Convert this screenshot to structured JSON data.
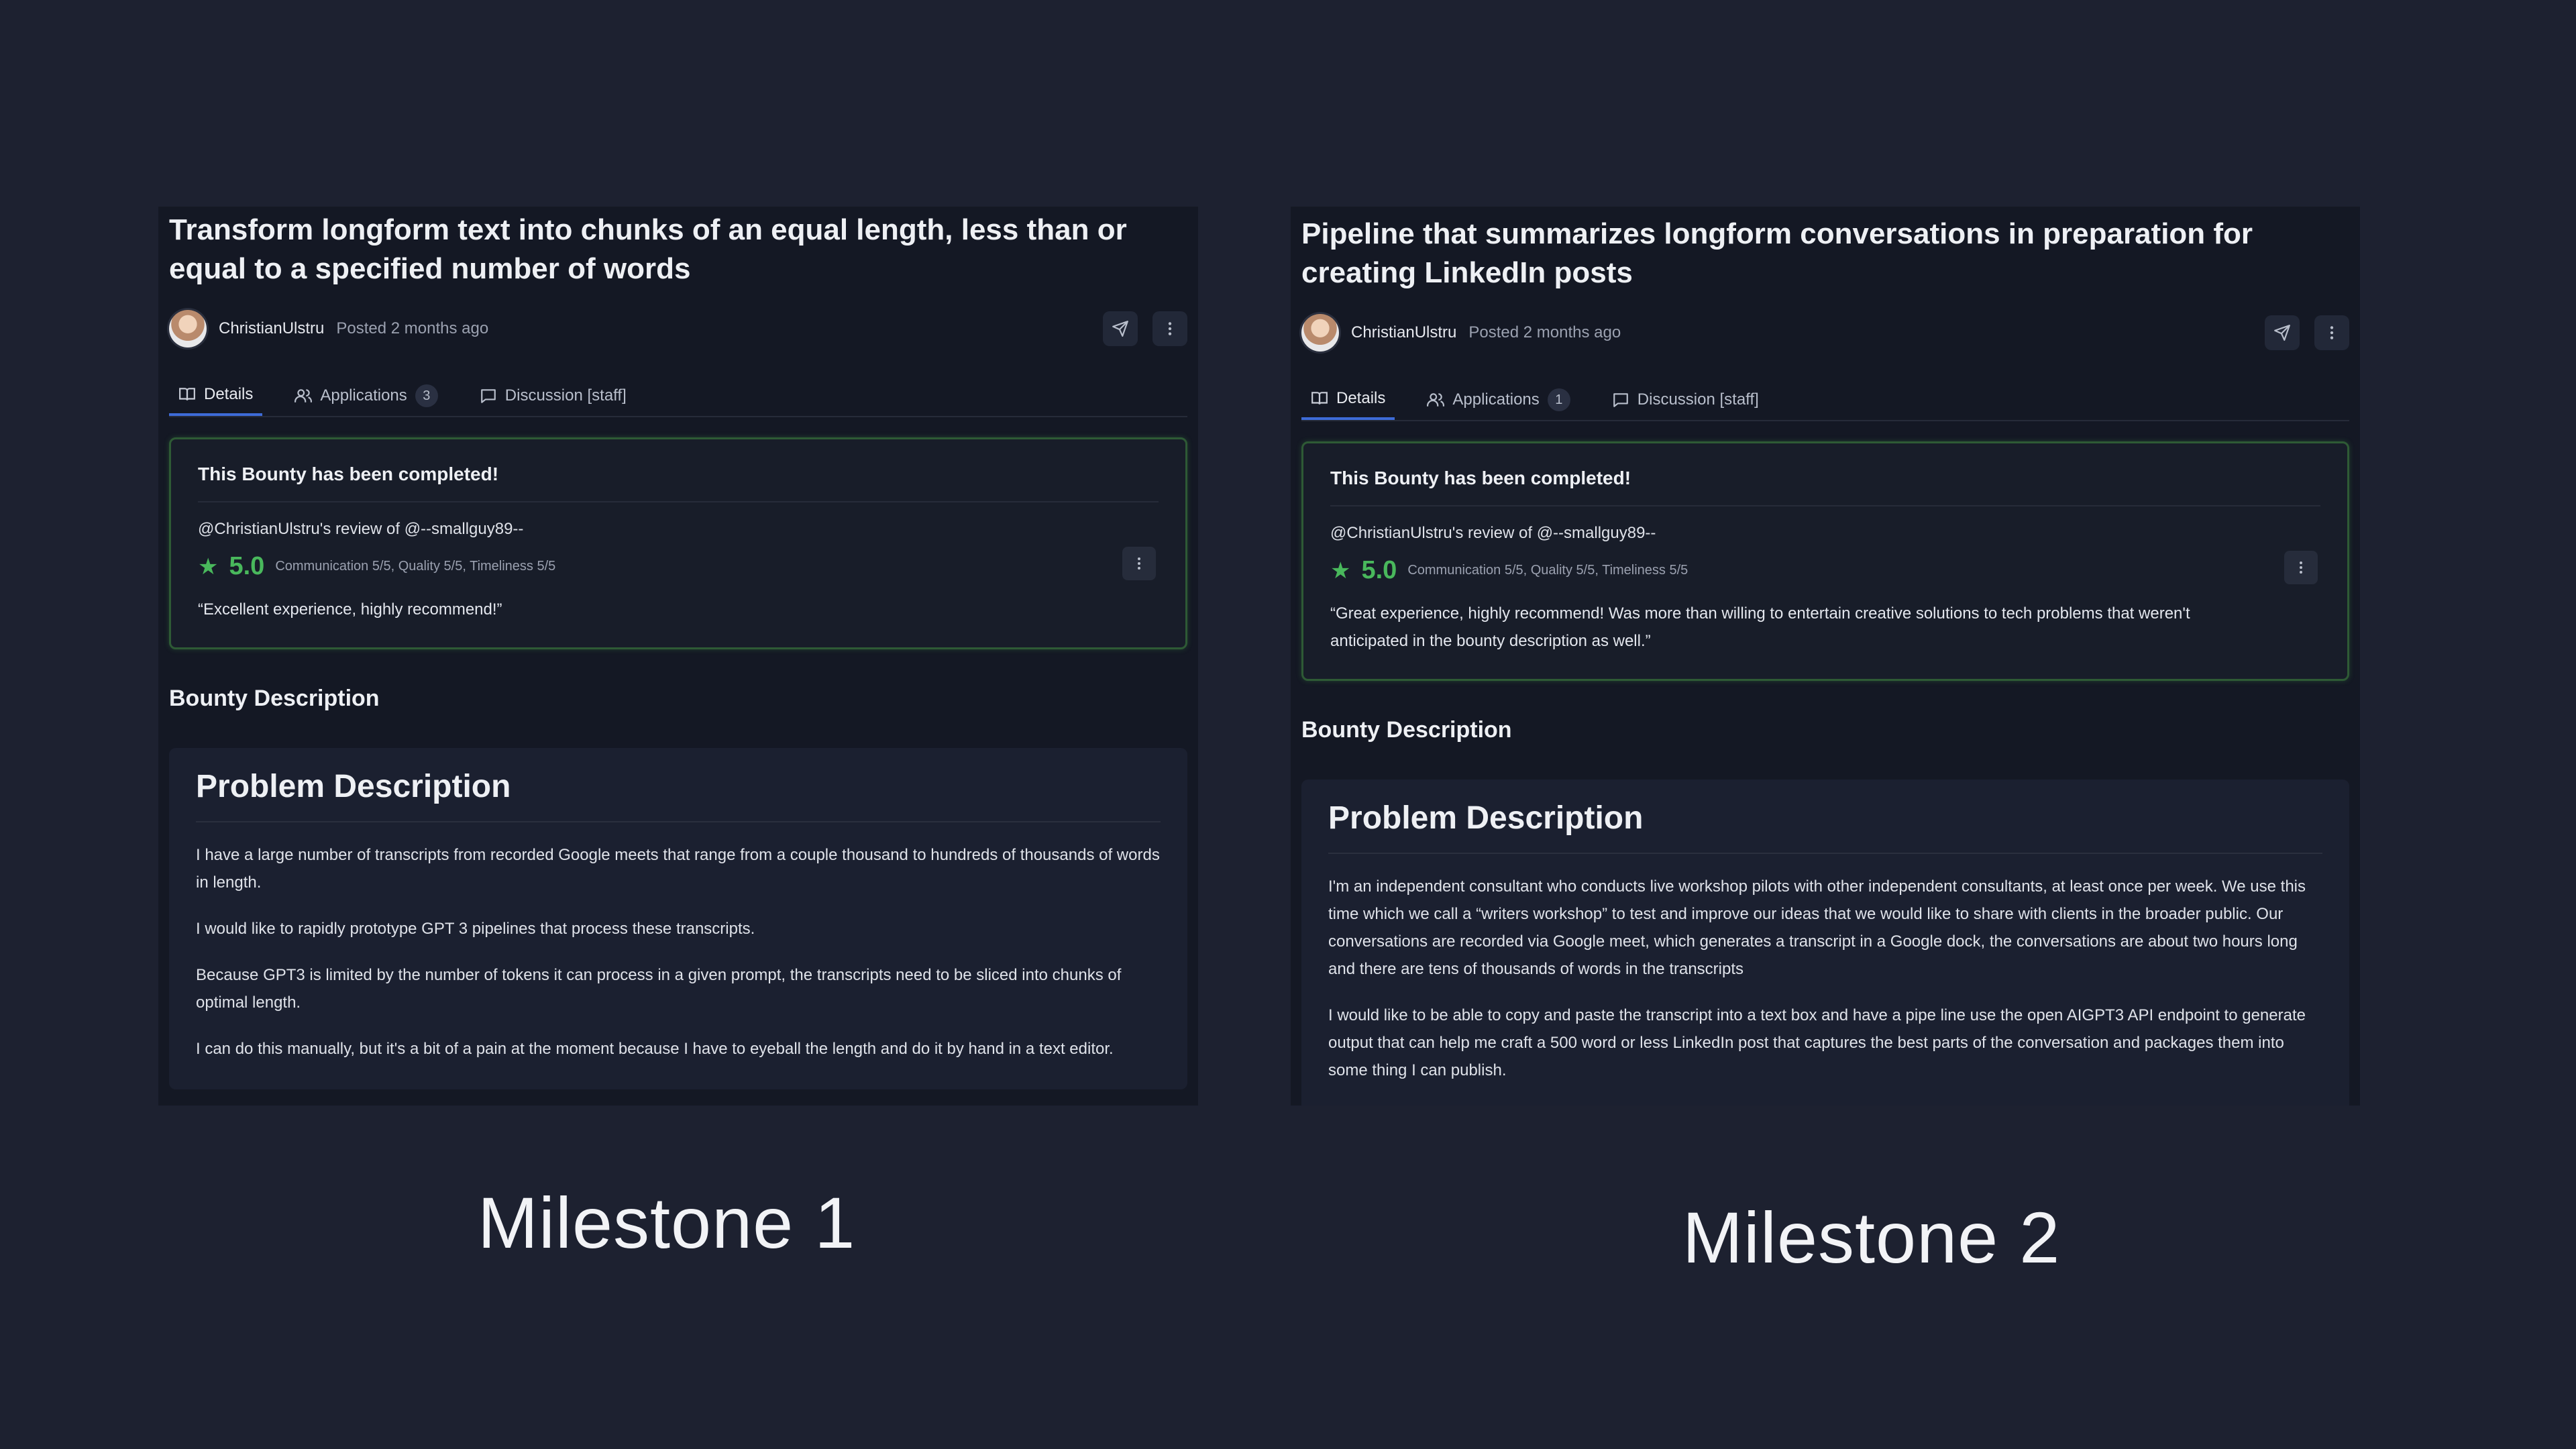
{
  "colors": {
    "background": "#1d2130",
    "panel": "#141824",
    "success": "#49b85c",
    "tab_active": "#3d6bd8"
  },
  "panels": [
    {
      "title": "Transform longform text into chunks of an equal length, less than or equal to a specified number of words",
      "username": "ChristianUlstru",
      "posted": "Posted 2 months ago",
      "tabs": {
        "details": "Details",
        "applications": "Applications",
        "applications_count": "3",
        "discussion": "Discussion [staff]"
      },
      "completed": {
        "title": "This Bounty has been completed!",
        "review_head": "@ChristianUlstru's review of @--smallguy89--",
        "rating": "5.0",
        "breakdown": "Communication 5/5, Quality 5/5, Timeliness 5/5",
        "quote": "“Excellent experience, highly recommend!”"
      },
      "section_heading": "Bounty Description",
      "desc_title": "Problem Description",
      "paragraphs": [
        "I have a large number of transcripts from recorded Google meets that range from a couple thousand to hundreds of thousands of words in length.",
        "I would like to rapidly prototype GPT 3 pipelines that process these transcripts.",
        "Because GPT3 is limited by the number of tokens it can process in a given prompt, the transcripts need to be sliced into chunks of optimal length.",
        "I can do this manually, but it's a bit of a pain at the moment because I have to eyeball the length and do it by hand in a text editor."
      ],
      "milestone": "Milestone 1"
    },
    {
      "title": "Pipeline that summarizes longform conversations in preparation for creating LinkedIn posts",
      "username": "ChristianUlstru",
      "posted": "Posted 2 months ago",
      "tabs": {
        "details": "Details",
        "applications": "Applications",
        "applications_count": "1",
        "discussion": "Discussion [staff]"
      },
      "completed": {
        "title": "This Bounty has been completed!",
        "review_head": "@ChristianUlstru's review of @--smallguy89--",
        "rating": "5.0",
        "breakdown": "Communication 5/5, Quality 5/5, Timeliness 5/5",
        "quote": "“Great experience, highly recommend! Was more than willing to entertain creative solutions to tech problems that weren't anticipated in the bounty description as well.”"
      },
      "section_heading": "Bounty Description",
      "desc_title": "Problem Description",
      "paragraphs": [
        "I'm an independent consultant who conducts live workshop pilots with other independent consultants, at least once per week. We use this time which we call a “writers workshop” to test and improve our ideas that we would like to share with clients in the broader public. Our conversations are recorded via Google meet, which generates a transcript in a Google dock, the conversations are about two hours long and there are tens of thousands of words in the transcripts",
        "I would like to be able to copy and paste the transcript into a text box and have a pipe line use the open AIGPT3 API endpoint to generate output that can help me craft a 500 word or less LinkedIn post that captures the best parts of the conversation and packages them into some thing I can publish."
      ],
      "milestone": "Milestone 2"
    }
  ]
}
